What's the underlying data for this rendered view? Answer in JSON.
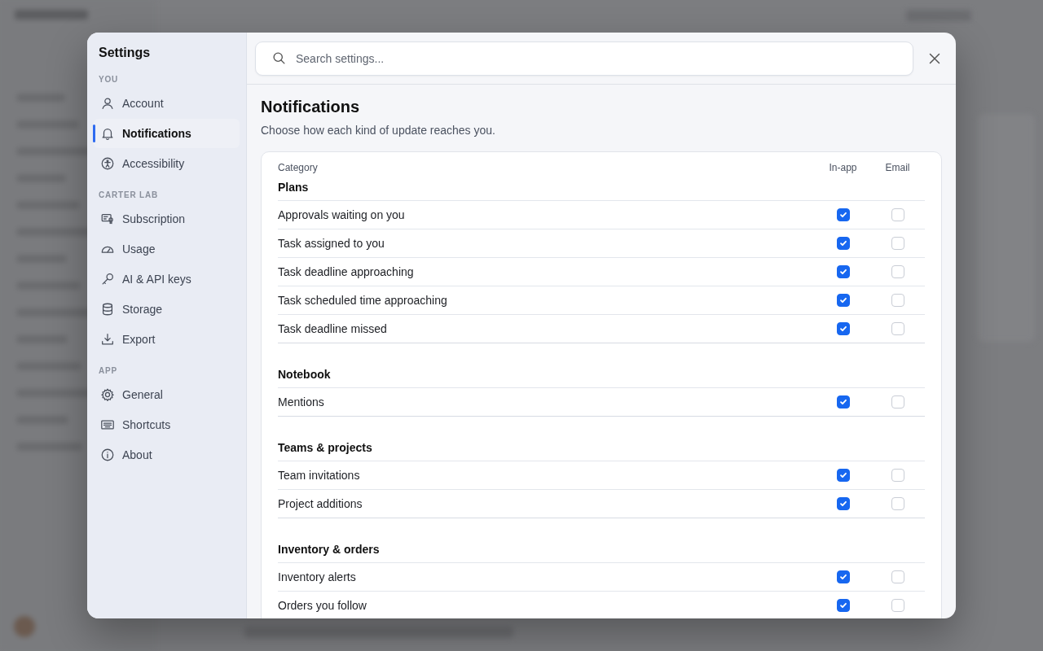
{
  "sidebar": {
    "title": "Settings",
    "sections": [
      {
        "heading": "YOU",
        "items": [
          {
            "label": "Account",
            "kind": "person",
            "selected": false
          },
          {
            "label": "Notifications",
            "kind": "bell",
            "selected": true
          },
          {
            "label": "Accessibility",
            "kind": "accessibility",
            "selected": false
          }
        ]
      },
      {
        "heading": "CARTER LAB",
        "items": [
          {
            "label": "Subscription",
            "kind": "certificate",
            "selected": false
          },
          {
            "label": "Usage",
            "kind": "gauge",
            "selected": false
          },
          {
            "label": "AI & API keys",
            "kind": "key",
            "selected": false
          },
          {
            "label": "Storage",
            "kind": "database",
            "selected": false
          },
          {
            "label": "Export",
            "kind": "download",
            "selected": false
          }
        ]
      },
      {
        "heading": "APP",
        "items": [
          {
            "label": "General",
            "kind": "gear",
            "selected": false
          },
          {
            "label": "Shortcuts",
            "kind": "keyboard",
            "selected": false
          },
          {
            "label": "About",
            "kind": "info",
            "selected": false
          }
        ]
      }
    ]
  },
  "search": {
    "placeholder": "Search settings..."
  },
  "page": {
    "title": "Notifications",
    "subtitle": "Choose how each kind of update reaches you."
  },
  "table": {
    "columns": [
      "Category",
      "In-app",
      "Email"
    ],
    "groups": [
      {
        "title": "Plans",
        "rows": [
          {
            "label": "Approvals waiting on you",
            "in_app": true,
            "email": false
          },
          {
            "label": "Task assigned to you",
            "in_app": true,
            "email": false
          },
          {
            "label": "Task deadline approaching",
            "in_app": true,
            "email": false
          },
          {
            "label": "Task scheduled time approaching",
            "in_app": true,
            "email": false
          },
          {
            "label": "Task deadline missed",
            "in_app": true,
            "email": false
          }
        ]
      },
      {
        "title": "Notebook",
        "rows": [
          {
            "label": "Mentions",
            "in_app": true,
            "email": false
          }
        ]
      },
      {
        "title": "Teams & projects",
        "rows": [
          {
            "label": "Team invitations",
            "in_app": true,
            "email": false
          },
          {
            "label": "Project additions",
            "in_app": true,
            "email": false
          }
        ]
      },
      {
        "title": "Inventory & orders",
        "rows": [
          {
            "label": "Inventory alerts",
            "in_app": true,
            "email": false
          },
          {
            "label": "Orders you follow",
            "in_app": true,
            "email": false
          }
        ]
      }
    ]
  }
}
